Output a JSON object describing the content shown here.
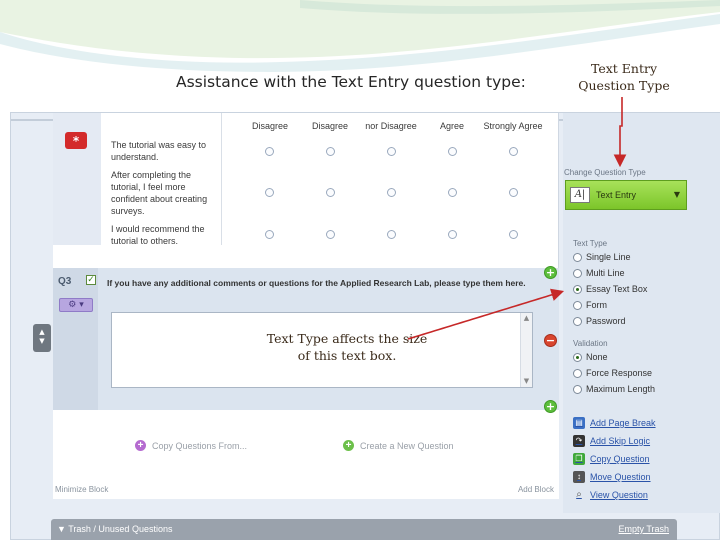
{
  "slide": {
    "title": "Assistance with the Text Entry question type:",
    "callout_top": "Text Entry Question Type",
    "callout_bottom": "Text Type affects the size of this text box."
  },
  "matrix": {
    "required_badge": "*",
    "columns": [
      "Disagree",
      "Disagree",
      "nor Disagree",
      "Agree",
      "Strongly Agree"
    ],
    "statements": [
      "The tutorial was easy to understand.",
      "After completing the tutorial, I feel more confident about creating surveys.",
      "I would recommend the tutorial to others."
    ]
  },
  "q3": {
    "label": "Q3",
    "question_text": "If you have any additional comments or questions for the Applied Research Lab, please type them here."
  },
  "block": {
    "copy_questions": "Copy Questions From...",
    "create_question": "Create a New Question",
    "minimize": "Minimize Block",
    "add_block": "Add Block"
  },
  "right_panel": {
    "change_type_label": "Change Question Type",
    "question_type": "Text Entry",
    "text_type_label": "Text Type",
    "text_types": [
      "Single Line",
      "Multi Line",
      "Essay Text Box",
      "Form",
      "Password"
    ],
    "text_type_selected": "Essay Text Box",
    "validation_label": "Validation",
    "validation_options": [
      "None",
      "Force Response",
      "Maximum Length"
    ],
    "validation_selected": "None",
    "actions": [
      "Add Page Break",
      "Add Skip Logic",
      "Copy Question",
      "Move Question",
      "View Question"
    ]
  },
  "trash": {
    "label": "▼ Trash / Unused Questions",
    "empty": "Empty Trash"
  },
  "colors": {
    "accent_green": "#7cc52a",
    "link_blue": "#2a53a8",
    "required_red": "#d32a2a",
    "arrow_red": "#c62828"
  }
}
